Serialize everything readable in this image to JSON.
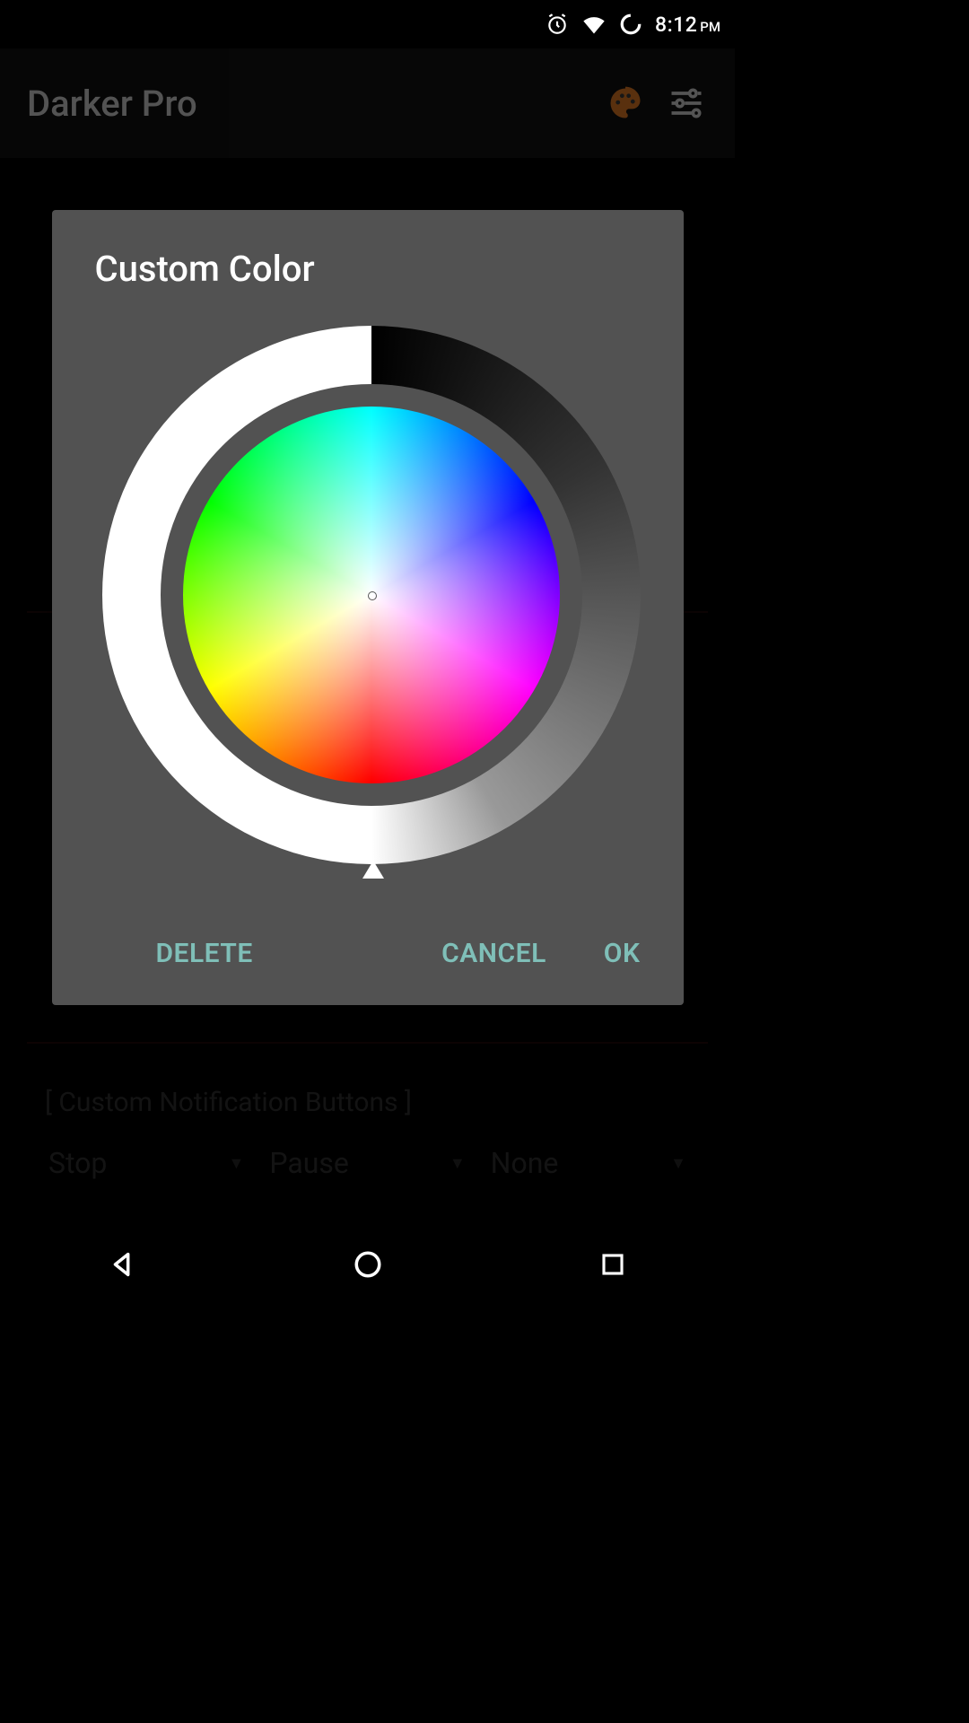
{
  "status": {
    "time": "8:12",
    "ampm": "PM"
  },
  "appbar": {
    "title": "Darker Pro"
  },
  "dialog": {
    "title": "Custom Color",
    "delete": "DELETE",
    "cancel": "CANCEL",
    "ok": "OK"
  },
  "notifications": {
    "label": "[ Custom Notification Buttons ]",
    "options": [
      "Stop",
      "Pause",
      "None"
    ]
  }
}
